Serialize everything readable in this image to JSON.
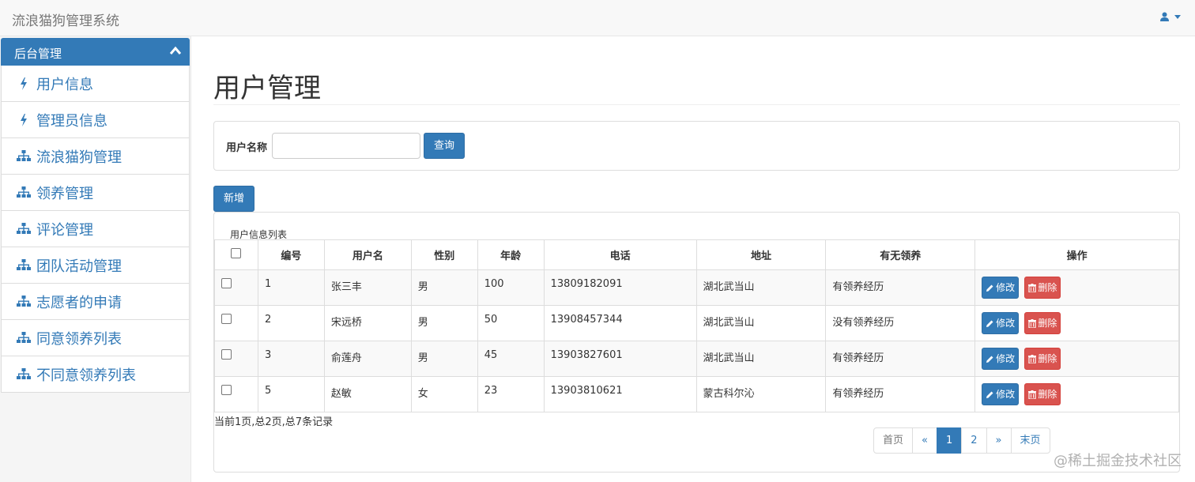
{
  "app": {
    "brand": "流浪猫狗管理系统"
  },
  "sidebar": {
    "header": "后台管理",
    "items": [
      {
        "label": "用户信息",
        "icon": "bolt-icon"
      },
      {
        "label": "管理员信息",
        "icon": "bolt-icon"
      },
      {
        "label": "流浪猫狗管理",
        "icon": "sitemap-icon"
      },
      {
        "label": "领养管理",
        "icon": "sitemap-icon"
      },
      {
        "label": "评论管理",
        "icon": "sitemap-icon"
      },
      {
        "label": "团队活动管理",
        "icon": "sitemap-icon"
      },
      {
        "label": "志愿者的申请",
        "icon": "sitemap-icon"
      },
      {
        "label": "同意领养列表",
        "icon": "sitemap-icon"
      },
      {
        "label": "不同意领养列表",
        "icon": "sitemap-icon"
      }
    ]
  },
  "main": {
    "title": "用户管理",
    "search": {
      "label": "用户名称",
      "value": "",
      "placeholder": "",
      "button": "查询"
    },
    "add_button": "新增",
    "table": {
      "caption": "用户信息列表",
      "headers": [
        "编号",
        "用户名",
        "性别",
        "年龄",
        "电话",
        "地址",
        "有无领养",
        "操作"
      ],
      "rows": [
        {
          "id": "1",
          "name": "张三丰",
          "gender": "男",
          "age": "100",
          "phone": "13809182091",
          "address": "湖北武当山",
          "adopt": "有领养经历"
        },
        {
          "id": "2",
          "name": "宋远桥",
          "gender": "男",
          "age": "50",
          "phone": "13908457344",
          "address": "湖北武当山",
          "adopt": "没有领养经历"
        },
        {
          "id": "3",
          "name": "俞莲舟",
          "gender": "男",
          "age": "45",
          "phone": "13903827601",
          "address": "湖北武当山",
          "adopt": "有领养经历"
        },
        {
          "id": "5",
          "name": "赵敏",
          "gender": "女",
          "age": "23",
          "phone": "13903810621",
          "address": "蒙古科尔沁",
          "adopt": "有领养经历"
        }
      ],
      "edit_label": "修改",
      "delete_label": "删除"
    },
    "summary": "当前1页,总2页,总7条记录",
    "pagination": [
      "首页",
      "«",
      "1",
      "2",
      "»",
      "末页"
    ],
    "active_page": "1"
  },
  "watermark": "@稀土掘金技术社区",
  "colors": {
    "primary": "#337ab7",
    "danger": "#d9534f",
    "navbar": "#f8f8f8"
  }
}
